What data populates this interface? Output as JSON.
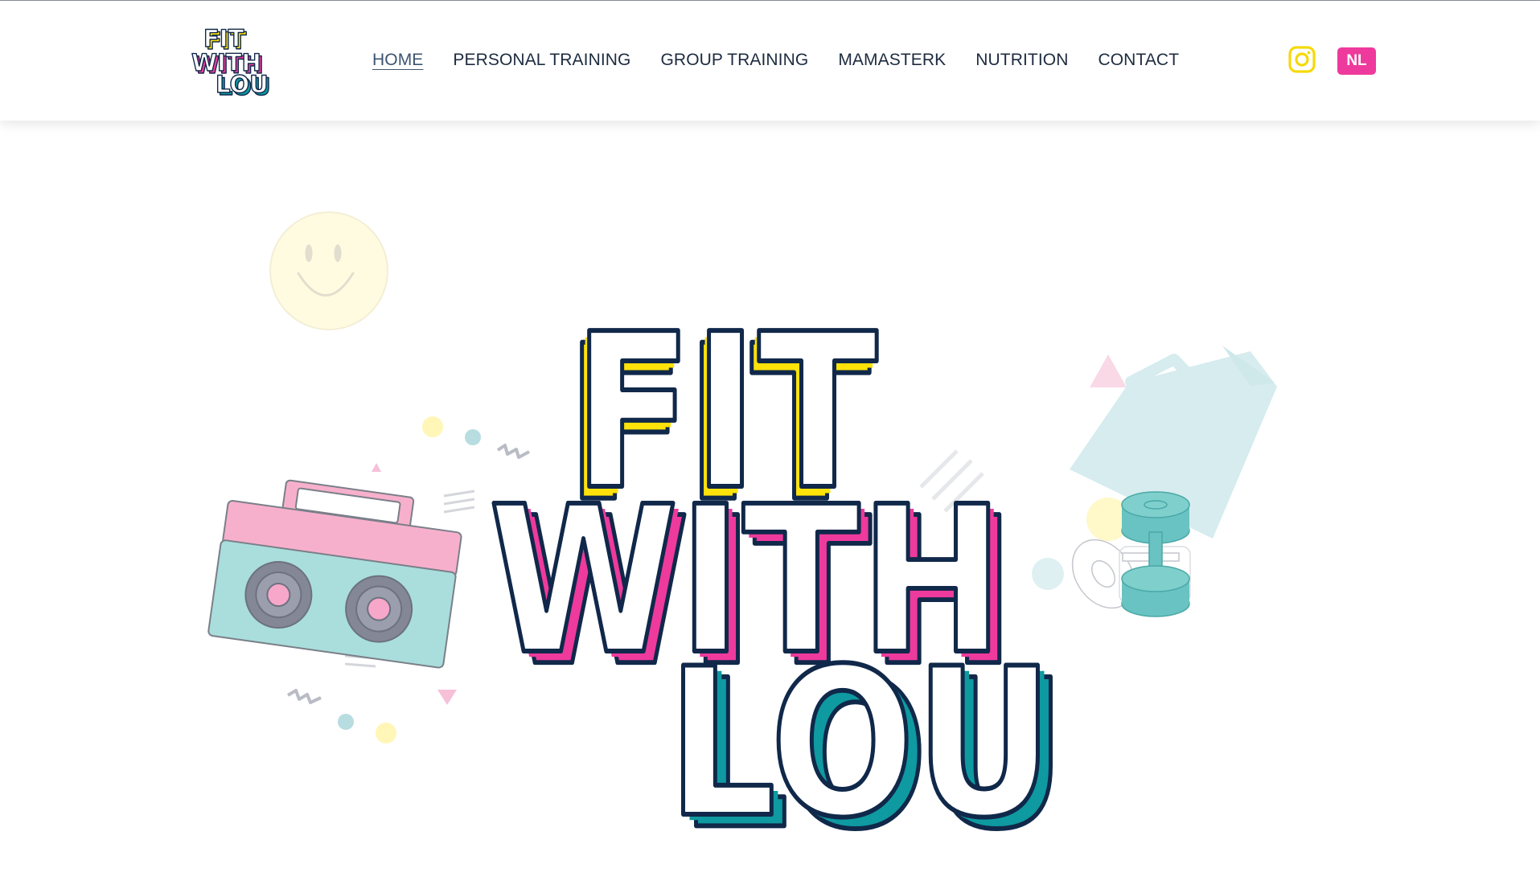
{
  "brand": {
    "logo_lines": [
      "FIT",
      "WITH",
      "LOU"
    ],
    "colors": {
      "yellow": "#ffe20a",
      "pink": "#ee3a9c",
      "teal": "#0e9aa0",
      "navy": "#10284a"
    }
  },
  "nav": {
    "items": [
      {
        "label": "HOME",
        "active": true
      },
      {
        "label": "PERSONAL TRAINING",
        "active": false
      },
      {
        "label": "GROUP TRAINING",
        "active": false
      },
      {
        "label": "MAMASTERK",
        "active": false
      },
      {
        "label": "NUTRITION",
        "active": false
      },
      {
        "label": "CONTACT",
        "active": false
      }
    ]
  },
  "header_actions": {
    "instagram_icon": "instagram-icon",
    "language_label": "NL"
  },
  "hero": {
    "title_lines": [
      "FIT",
      "WITH",
      "LOU"
    ],
    "decorations": [
      "smiley-icon",
      "boombox-icon",
      "megaphone-icon",
      "dumbbell-icon"
    ]
  }
}
